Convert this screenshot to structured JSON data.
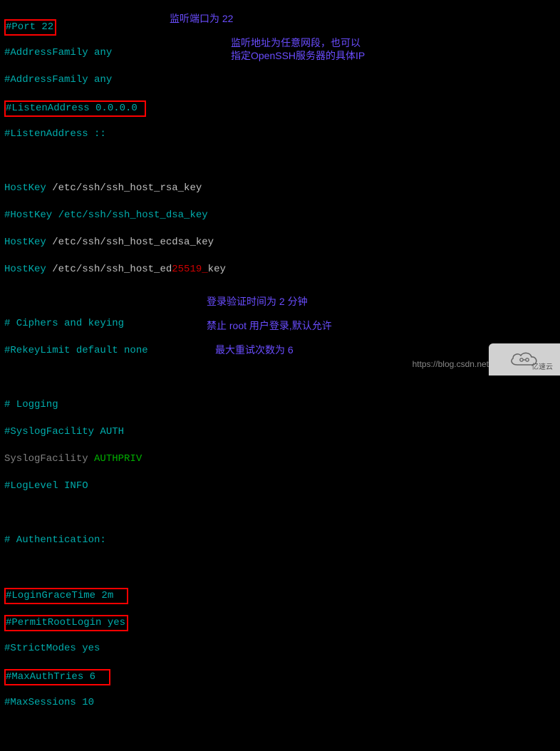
{
  "config": {
    "line01_port": "#Port 22",
    "line02_addrfam": "#AddressFamily any",
    "line03_addrfam": "#AddressFamily any",
    "line04_listenaddr": "#ListenAddress 0.0.0.0 ",
    "line05_listenaddr6": "#ListenAddress ::",
    "line06_blank": "",
    "line07_hk_key": "HostKey",
    "line07_hk_val": " /etc/ssh/ssh_host_rsa_key",
    "line08_hk_dsa": "#HostKey /etc/ssh/ssh_host_dsa_key",
    "line09_hk_key": "HostKey",
    "line09_hk_val": " /etc/ssh/ssh_host_ecdsa_key",
    "line10_hk_key": "HostKey",
    "line10_hk_val_a": " /etc/ssh/ssh_host_ed",
    "line10_hk_val_b": "25519_",
    "line10_hk_val_c": "key",
    "line11_blank": "",
    "line12_ciphers": "# Ciphers and keying",
    "line13_rekey": "#RekeyLimit default none",
    "line14_blank": "",
    "line15_logging": "# Logging",
    "line16_syslog": "#SyslogFacility AUTH",
    "line17_syslog_key": "SyslogFacility",
    "line17_syslog_val": " AUTHPRIV",
    "line18_loglevel": "#LogLevel INFO",
    "line19_blank": "",
    "line20_auth": "# Authentication:",
    "line21_blank": "",
    "line22_logingrace": "#LoginGraceTime 2m  ",
    "line23_permitroot": "#PermitRootLogin yes",
    "line24_strictmodes": "#StrictModes yes",
    "line25_maxauth": "#MaxAuthTries 6  ",
    "line26_maxsessions": "#MaxSessions 10",
    "line27_blank": ""
  },
  "annotations": {
    "a1": "监听端口为 22",
    "a2_l1": "监听地址为任意网段，也可以",
    "a2_l2": "指定OpenSSH服务器的具体IP",
    "a3": "登录验证时间为 2 分钟",
    "a4": "禁止 root 用户登录,默认允许",
    "a5": "最大重试次数为 6"
  },
  "watermark": {
    "url": "https://blog.csdn.net",
    "brand": "亿速云"
  }
}
